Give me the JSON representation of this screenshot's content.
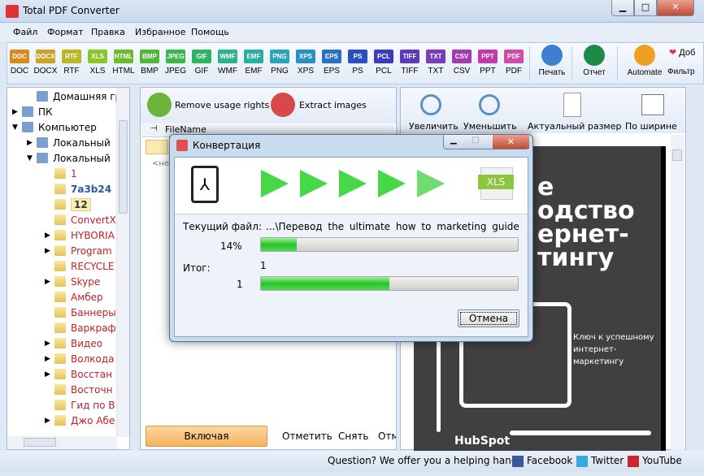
{
  "window": {
    "title": "Total PDF Converter",
    "min": "▁",
    "max": "□",
    "close": "✕"
  },
  "menu": [
    "Файл",
    "Формат",
    "Правка",
    "Избранное",
    "Помощь"
  ],
  "formats": [
    {
      "label": "DOC",
      "color": "#d88a1e"
    },
    {
      "label": "DOCX",
      "color": "#c9a22a"
    },
    {
      "label": "RTF",
      "color": "#b8b823"
    },
    {
      "label": "XLS",
      "color": "#8cc62a"
    },
    {
      "label": "HTML",
      "color": "#6cbb2c"
    },
    {
      "label": "BMP",
      "color": "#4fb83a"
    },
    {
      "label": "JPEG",
      "color": "#3cb548"
    },
    {
      "label": "GIF",
      "color": "#2fb262"
    },
    {
      "label": "WMF",
      "color": "#2eb28c"
    },
    {
      "label": "EMF",
      "color": "#2aae9e"
    },
    {
      "label": "PNG",
      "color": "#2aa5b8"
    },
    {
      "label": "XPS",
      "color": "#2a90c4"
    },
    {
      "label": "EPS",
      "color": "#2a6fc4"
    },
    {
      "label": "PS",
      "color": "#2a50c0"
    },
    {
      "label": "PCL",
      "color": "#3a3cb8"
    },
    {
      "label": "TIFF",
      "color": "#5a3cb8"
    },
    {
      "label": "TXT",
      "color": "#7a3cb4"
    },
    {
      "label": "CSV",
      "color": "#a03cb0"
    },
    {
      "label": "PPT",
      "color": "#c03cae"
    },
    {
      "label": "PDF",
      "color": "#d04aa8"
    }
  ],
  "actions": {
    "print": "Печать",
    "report": "Отчет",
    "automate": "Automate",
    "filter": "Фильтр",
    "add": "Доб"
  },
  "tree": [
    {
      "label": "Домашняя гру",
      "color": "#000",
      "level": 1,
      "expander": ""
    },
    {
      "label": "ПК",
      "color": "#000",
      "level": 0,
      "expander": "▶"
    },
    {
      "label": "Компьютер",
      "color": "#000",
      "level": 0,
      "expander": "▼"
    },
    {
      "label": "Локальный",
      "color": "#000",
      "level": 1,
      "expander": "▶"
    },
    {
      "label": "Локальный",
      "color": "#000",
      "level": 1,
      "expander": "▼"
    },
    {
      "label": "1",
      "color": "#c0202a",
      "level": 2,
      "expander": ""
    },
    {
      "label": "7a3b24",
      "color": "#2a5a9a",
      "level": 2,
      "expander": ""
    },
    {
      "label": "12",
      "color": "#333",
      "level": 2,
      "expander": "",
      "selected": true
    },
    {
      "label": "ConvertX",
      "color": "#c0202a",
      "level": 2,
      "expander": ""
    },
    {
      "label": "HYBORIA",
      "color": "#c0202a",
      "level": 2,
      "expander": "▶"
    },
    {
      "label": "Program",
      "color": "#c0202a",
      "level": 2,
      "expander": "▶"
    },
    {
      "label": "RECYCLE",
      "color": "#c0202a",
      "level": 2,
      "expander": ""
    },
    {
      "label": "Skype",
      "color": "#c0202a",
      "level": 2,
      "expander": "▶"
    },
    {
      "label": "Амбер",
      "color": "#c0202a",
      "level": 2,
      "expander": ""
    },
    {
      "label": "Баннеры",
      "color": "#c0202a",
      "level": 2,
      "expander": ""
    },
    {
      "label": "Варкраф",
      "color": "#c0202a",
      "level": 2,
      "expander": ""
    },
    {
      "label": "Видео",
      "color": "#c0202a",
      "level": 2,
      "expander": "▶"
    },
    {
      "label": "Волкода",
      "color": "#c0202a",
      "level": 2,
      "expander": "▶"
    },
    {
      "label": "Восстан",
      "color": "#c0202a",
      "level": 2,
      "expander": "▶"
    },
    {
      "label": "Восточн",
      "color": "#c0202a",
      "level": 2,
      "expander": ""
    },
    {
      "label": "Гид по В",
      "color": "#c0202a",
      "level": 2,
      "expander": ""
    },
    {
      "label": "Джо Абе",
      "color": "#c0202a",
      "level": 2,
      "expander": "▶"
    }
  ],
  "middle": {
    "remove_rights": "Remove usage rights",
    "extract_images": "Extract images",
    "col_filename": "FileName",
    "empty_row": "<не",
    "include_subdirs": "Включая поддиректории",
    "mark": "Отметить",
    "unmark": "Снять",
    "other": "Отм"
  },
  "preview": {
    "zoom_in": "Увеличить",
    "zoom_out": "Уменьшить",
    "actual": "Актуальный размер",
    "fit_width": "По ширине",
    "title_lines": [
      "е",
      "одство",
      "ернет-",
      "тингу"
    ],
    "subtitle_lines": [
      "Ключ к успешному",
      "интернет-маркетингу"
    ],
    "logo": "HubSpot"
  },
  "status": {
    "question": "Question? We offer you a helping hand -",
    "facebook": "Facebook",
    "twitter": "Twitter",
    "youtube": "YouTube"
  },
  "dialog": {
    "title": "Конвертация",
    "target_format": "XLS",
    "current_file_label": "Текущий файл:",
    "current_file": "...\\Перевод the ultimate how to marketing guide",
    "file_percent": "14%",
    "file_progress": 14,
    "total_label": "Итог:",
    "total_count": "1",
    "total_done": "1",
    "total_progress": 50,
    "cancel": "Отмена"
  }
}
